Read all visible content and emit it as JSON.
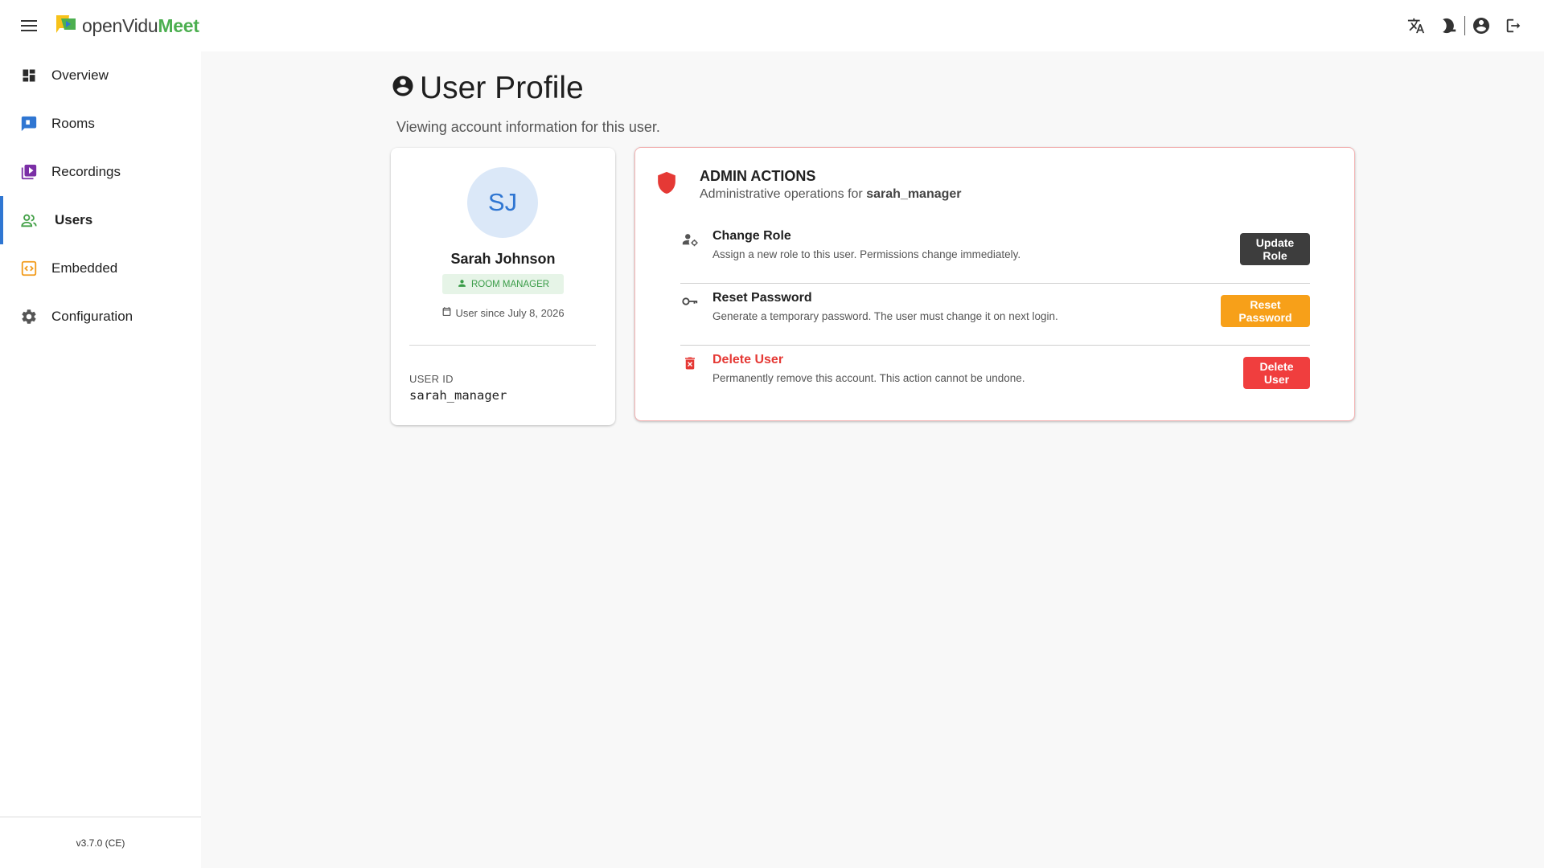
{
  "app": {
    "logo_open": "openVidu",
    "logo_meet": "Meet"
  },
  "icons": {
    "menu": "menu-icon",
    "logo": "openvidu-logo-icon",
    "translate": "translate-icon",
    "theme": "dark-mode-icon",
    "account": "account-circle-icon",
    "logout": "logout-icon"
  },
  "colors": {
    "accent": "#2f76d2",
    "meet_green": "#4caf50",
    "danger": "#f03e3e",
    "warning": "#f7a019",
    "dark": "#3d3d3d"
  },
  "sidebar": {
    "items": [
      {
        "label": "Overview",
        "icon": "dashboard-icon"
      },
      {
        "label": "Rooms",
        "icon": "rooms-icon"
      },
      {
        "label": "Recordings",
        "icon": "recordings-icon"
      },
      {
        "label": "Users",
        "icon": "users-icon",
        "active": true
      },
      {
        "label": "Embedded",
        "icon": "embedded-icon"
      },
      {
        "label": "Configuration",
        "icon": "settings-icon"
      }
    ],
    "version": "v3.7.0 (CE)"
  },
  "page": {
    "title": "User Profile",
    "subtitle": "Viewing account information for this user."
  },
  "profile": {
    "initials": "SJ",
    "name": "Sarah Johnson",
    "role": "ROOM MANAGER",
    "member_since": "User since July 8, 2026",
    "user_id_label": "USER ID",
    "user_id": "sarah_manager"
  },
  "admin": {
    "title": "ADMIN ACTIONS",
    "subtitle_prefix": "Administrative operations for",
    "subtitle_user": "sarah_manager",
    "actions": [
      {
        "title": "Change Role",
        "description": "Assign a new role to this user. Permissions change immediately.",
        "button": "Update Role"
      },
      {
        "title": "Reset Password",
        "description": "Generate a temporary password. The user must change it on next login.",
        "button": "Reset Password"
      },
      {
        "title": "Delete User",
        "description": "Permanently remove this account. This action cannot be undone.",
        "button": "Delete User"
      }
    ]
  }
}
